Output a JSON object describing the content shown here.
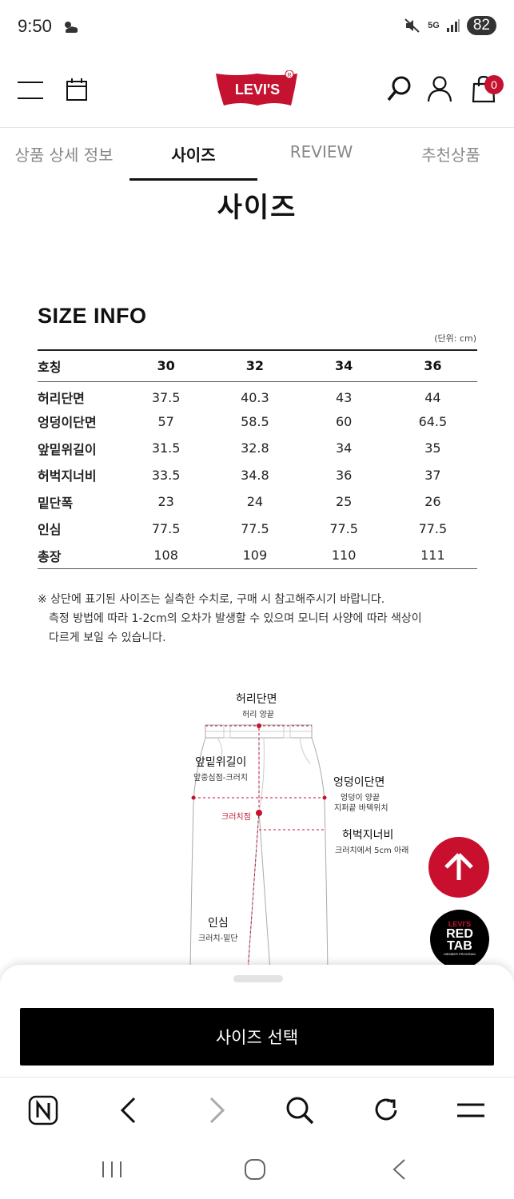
{
  "status_bar": {
    "time": "9:50",
    "battery": "82",
    "network": "5G"
  },
  "header": {
    "logo_text": "LEVI'S",
    "cart_count": "0",
    "brand_color": "#c41230"
  },
  "tabs": [
    {
      "label": "상품 상세 정보",
      "active": false
    },
    {
      "label": "사이즈",
      "active": true
    },
    {
      "label": "REVIEW",
      "active": false
    },
    {
      "label": "추천상품",
      "active": false
    }
  ],
  "page_title": "사이즈",
  "size_info": {
    "heading": "SIZE INFO",
    "unit": "(단위: cm)",
    "header_row": [
      "호칭",
      "30",
      "32",
      "34",
      "36"
    ],
    "rows": [
      [
        "허리단면",
        "37.5",
        "40.3",
        "43",
        "44"
      ],
      [
        "엉덩이단면",
        "57",
        "58.5",
        "60",
        "64.5"
      ],
      [
        "앞밑위길이",
        "31.5",
        "32.8",
        "34",
        "35"
      ],
      [
        "허벅지너비",
        "33.5",
        "34.8",
        "36",
        "37"
      ],
      [
        "밑단폭",
        "23",
        "24",
        "25",
        "26"
      ],
      [
        "인심",
        "77.5",
        "77.5",
        "77.5",
        "77.5"
      ],
      [
        "총장",
        "108",
        "109",
        "110",
        "111"
      ]
    ],
    "note_line1": "※ 상단에 표기된 사이즈는 실측한 수치로, 구매 시 참고해주시기 바랍니다.",
    "note_line2": "측정 방법에 따라 1-2cm의 오차가 발생할 수 있으며 모니터 사양에 따라 색상이",
    "note_line3": "다르게 보일 수 있습니다."
  },
  "diagram": {
    "waist": "허리단면",
    "waist_sub": "허리 양끝",
    "rise": "앞밑위길이",
    "rise_sub": "앞중심점-크러치",
    "hip": "엉덩이단면",
    "hip_sub1": "엉덩이 양끝",
    "hip_sub2": "지퍼끝 바텍위치",
    "crotch_point": "크러치점",
    "thigh": "허벅지너비",
    "thigh_sub": "크러치에서 5cm 아래",
    "inseam": "인심",
    "inseam_sub": "크러치-밑단"
  },
  "redtab": {
    "line1": "LEVI'S",
    "line2": "RED",
    "line3": "TAB",
    "line4": "MEMBER PROGRAM"
  },
  "sheet": {
    "button_label": "사이즈 선택"
  },
  "browser_bar": {
    "icons": [
      "naver-home-icon",
      "back-icon",
      "forward-icon",
      "search-icon",
      "reload-icon",
      "menu-icon"
    ]
  },
  "nav_bar": {
    "icons": [
      "recent-apps-icon",
      "home-icon",
      "back-icon"
    ]
  }
}
